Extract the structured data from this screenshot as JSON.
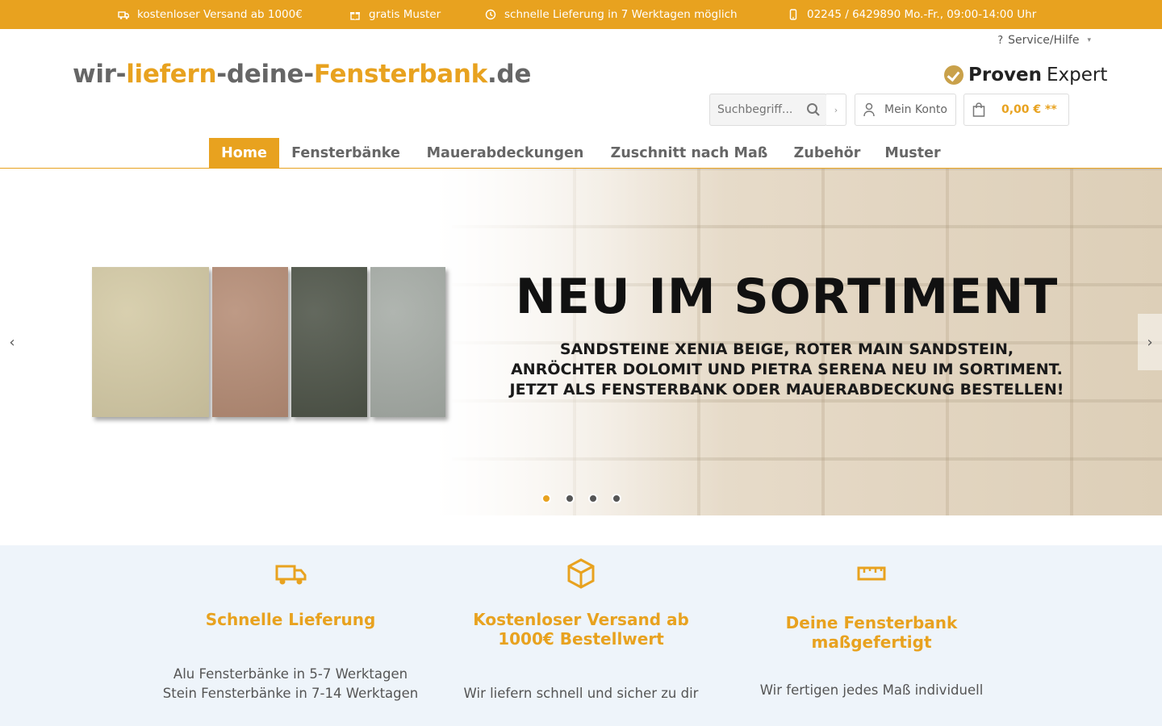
{
  "topbar": {
    "items": [
      {
        "label": "kostenloser Versand ab 1000€",
        "icon": "truck-icon"
      },
      {
        "label": "gratis Muster",
        "icon": "gift-icon"
      },
      {
        "label": "schnelle Lieferung in 7 Werktagen möglich",
        "icon": "clock-icon"
      },
      {
        "label": "02245 / 6429890 Mo.-Fr., 09:00-14:00 Uhr",
        "icon": "phone-icon"
      }
    ]
  },
  "header": {
    "service_label": "Service/Hilfe",
    "logo": {
      "p1": "wir-",
      "p2": "liefern",
      "p3": "-deine-",
      "p4": "Fensterbank",
      "p5": ".de"
    },
    "proven": {
      "p1": "Proven",
      "p2": "Expert"
    },
    "search_placeholder": "Suchbegriff...",
    "account_label": "Mein Konto",
    "cart_label": "0,00 € **"
  },
  "nav": {
    "items": [
      "Home",
      "Fensterbänke",
      "Mauerabdeckungen",
      "Zuschnitt nach Maß",
      "Zubehör",
      "Muster"
    ]
  },
  "slider": {
    "headline": "NEU IM SORTIMENT",
    "sub1": "SANDSTEINE XENIA BEIGE, ROTER MAIN SANDSTEIN,",
    "sub2": "ANRÖCHTER DOLOMIT UND PIETRA SERENA NEU IM SORTIMENT.",
    "sub3": "JETZT ALS FENSTERBANK ODER MAUERABDECKUNG BESTELLEN!",
    "swatch_colors": [
      "#d3c9a4",
      "#b58c75",
      "#4e5448",
      "#a5aba5"
    ],
    "active_dot": 1,
    "dot_count": 4
  },
  "features": [
    {
      "title1": "Schnelle Lieferung",
      "title2": "",
      "line1": "Alu Fensterbänke in 5-7 Werktagen",
      "line2": "Stein Fensterbänke in 7-14 Werktagen",
      "icon": "truck-icon"
    },
    {
      "title1": "Kostenloser Versand ab",
      "title2": "1000€ Bestellwert",
      "line1": "",
      "line2": "Wir liefern schnell und sicher zu dir",
      "icon": "package-icon"
    },
    {
      "title1": "Deine Fensterbank",
      "title2": "maßgefertigt",
      "line1": "",
      "line2": "Wir fertigen jedes Maß individuell",
      "icon": "ruler-icon"
    }
  ],
  "colors": {
    "accent": "#e8a21f",
    "feature_bg": "#eef4fa",
    "text": "#555555"
  }
}
